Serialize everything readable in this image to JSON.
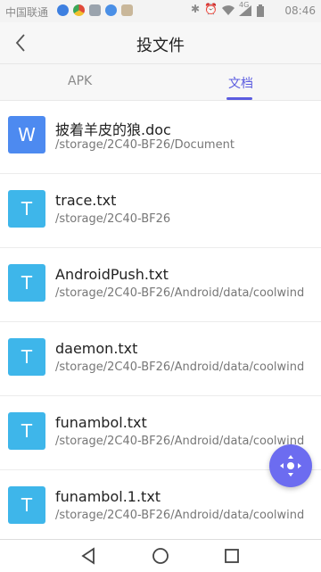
{
  "status_bar": {
    "carrier": "中国联通",
    "network": "4G",
    "time": "08:46",
    "icons": [
      "notification-app-icon",
      "chrome-icon",
      "image-icon",
      "message-icon",
      "avatar-icon",
      "bluetooth-icon",
      "alarm-icon",
      "wifi-icon",
      "signal-icon",
      "battery-icon"
    ]
  },
  "header": {
    "title": "投文件",
    "back_icon": "chevron-left-icon"
  },
  "tabs": [
    {
      "label": "APK",
      "active": false
    },
    {
      "label": "文档",
      "active": true
    }
  ],
  "accent_color": "#5b5ce0",
  "files": [
    {
      "icon_letter": "W",
      "icon_type": "word",
      "name": "披着羊皮的狼.doc",
      "path": "/storage/2C40-BF26/Document"
    },
    {
      "icon_letter": "T",
      "icon_type": "txt",
      "name": "trace.txt",
      "path": "/storage/2C40-BF26"
    },
    {
      "icon_letter": "T",
      "icon_type": "txt",
      "name": "AndroidPush.txt",
      "path": "/storage/2C40-BF26/Android/data/coolwind"
    },
    {
      "icon_letter": "T",
      "icon_type": "txt",
      "name": "daemon.txt",
      "path": "/storage/2C40-BF26/Android/data/coolwind"
    },
    {
      "icon_letter": "T",
      "icon_type": "txt",
      "name": "funambol.txt",
      "path": "/storage/2C40-BF26/Android/data/coolwind"
    },
    {
      "icon_letter": "T",
      "icon_type": "txt",
      "name": "funambol.1.txt",
      "path": "/storage/2C40-BF26/Android/data/coolwind"
    }
  ],
  "fab_icon": "dpad-navigation-icon",
  "nav_bar": [
    "back-triangle-icon",
    "home-circle-icon",
    "recents-square-icon"
  ]
}
